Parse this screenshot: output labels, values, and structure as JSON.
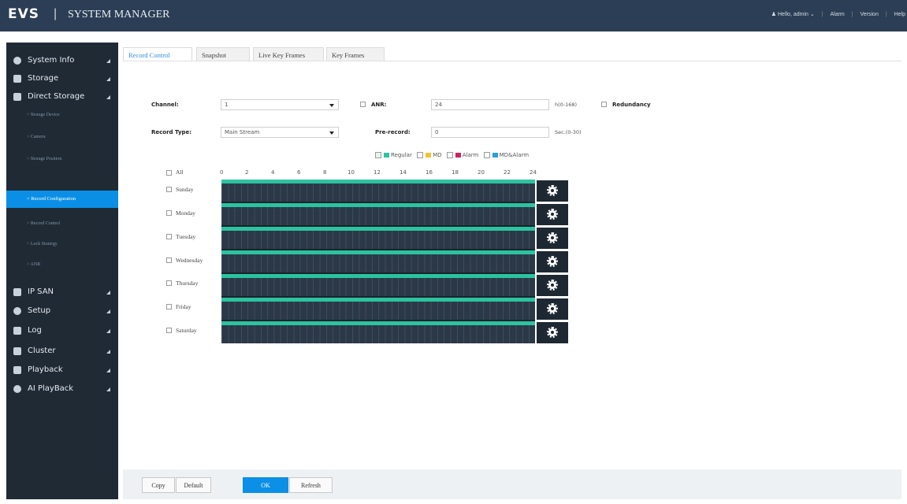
{
  "header": {
    "logo": "EVS",
    "title": "SYSTEM MANAGER",
    "user": "Hello, admin",
    "links": [
      "Alarm",
      "Version",
      "Help"
    ]
  },
  "sidebar": {
    "items": [
      {
        "label": "System Info"
      },
      {
        "label": "Storage"
      },
      {
        "label": "Direct Storage"
      },
      {
        "label": "IP SAN"
      },
      {
        "label": "Setup"
      },
      {
        "label": "Log"
      },
      {
        "label": "Cluster"
      },
      {
        "label": "Playback"
      },
      {
        "label": "AI PlayBack"
      }
    ],
    "sub_items": [
      {
        "label": "> Storage Device"
      },
      {
        "label": "> Camera"
      },
      {
        "label": "> Storage Position"
      },
      {
        "label": "> Record Configuration"
      },
      {
        "label": "> Record Control"
      },
      {
        "label": "> Lock Strategy"
      },
      {
        "label": "> ANR"
      }
    ],
    "active_sub": "> Record Configuration"
  },
  "tabs": [
    "Record Control",
    "Snapshot",
    "Live Key Frames",
    "Key Frames"
  ],
  "form": {
    "channel_label": "Channel:",
    "channel_value": "1",
    "anr_label": "ANR:",
    "anr_value": "24",
    "anr_unit": "h(0-168)",
    "redundancy_label": "Redundancy",
    "record_type_label": "Record Type:",
    "record_type_value": "Main Stream",
    "prerecord_label": "Pre-record:",
    "prerecord_value": "0",
    "prerecord_unit": "Sec.(0-30)"
  },
  "legend": {
    "regular": "Regular",
    "md": "MD",
    "alarm": "Alarm",
    "md_alarm": "MD&Alarm",
    "colors": {
      "regular": "#2bc3a0",
      "md": "#f2c12e",
      "alarm": "#d21f5a",
      "md_alarm": "#2a9fe0"
    }
  },
  "schedule": {
    "all_label": "All",
    "hours": [
      "0",
      "2",
      "4",
      "6",
      "8",
      "10",
      "12",
      "14",
      "16",
      "18",
      "20",
      "22",
      "24"
    ],
    "days": [
      "Sunday",
      "Monday",
      "Tuesday",
      "Wednesday",
      "Thursday",
      "Friday",
      "Saturday"
    ],
    "regular_span_hours": [
      0,
      24
    ]
  },
  "footer": {
    "copy": "Copy",
    "default": "Default",
    "ok": "OK",
    "refresh": "Refresh"
  }
}
